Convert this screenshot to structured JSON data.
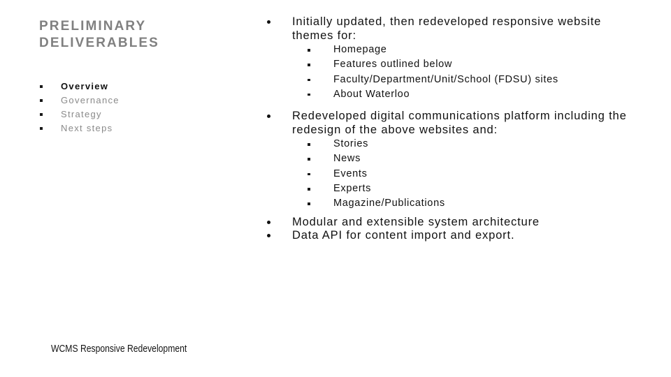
{
  "slide": {
    "heading": "PRELIMINARY\nDELIVERABLES",
    "footer": "WCMS Responsive Redevelopment",
    "colors": {
      "heading": "#808080",
      "agenda_inactive": "#8a8a8a",
      "agenda_active": "#111111",
      "body_text": "#111111",
      "background": "#ffffff"
    }
  },
  "agenda": {
    "items": [
      {
        "label": "Overview",
        "current": true
      },
      {
        "label": "Governance",
        "current": false
      },
      {
        "label": "Strategy",
        "current": false
      },
      {
        "label": "Next steps",
        "current": false
      }
    ]
  },
  "content": {
    "bullets": [
      {
        "text": "Initially updated, then redeveloped responsive website themes for:",
        "sub": [
          "Homepage",
          "Features outlined below",
          "Faculty/Department/Unit/School (FDSU) sites",
          "About Waterloo"
        ]
      },
      {
        "text": "Redeveloped digital communications platform including the redesign of the above websites and:",
        "sub": [
          "Stories",
          "News",
          "Events",
          "Experts",
          "Magazine/Publications"
        ]
      },
      {
        "text": "Modular and extensible system architecture",
        "sub": []
      },
      {
        "text": "Data API for content import and export.",
        "sub": []
      }
    ]
  }
}
